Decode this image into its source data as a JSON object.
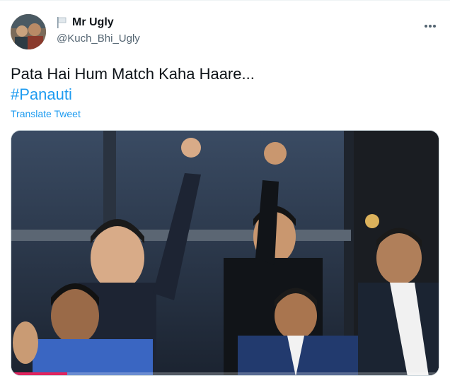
{
  "user": {
    "display_name": "Mr Ugly",
    "handle": "@Kuch_Bhi_Ugly",
    "avatar_icon": "avatar",
    "flag_icon": "flag-icon"
  },
  "menu": {
    "icon": "more-icon"
  },
  "tweet": {
    "text": "Pata Hai Hum Match Kaha Haare...",
    "hashtag": "#Panauti",
    "translate_label": "Translate Tweet"
  },
  "media": {
    "type": "video",
    "progress": 0.13,
    "colors": {
      "progress": "#e0245e"
    }
  },
  "colors": {
    "accent": "#1d9bf0",
    "muted": "#536471",
    "text": "#0f1419"
  }
}
